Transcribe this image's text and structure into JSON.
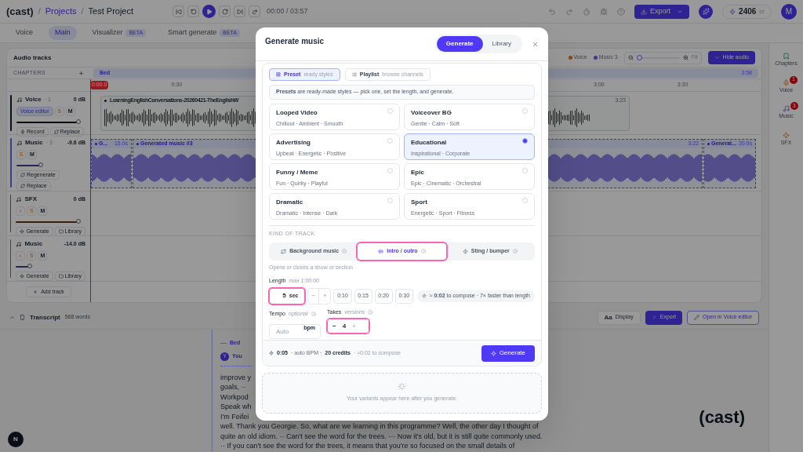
{
  "topbar": {
    "logo": "(cast)",
    "breadcrumbs": [
      {
        "separator": "/",
        "label": "Projects",
        "kind": "link"
      },
      {
        "separator": "/",
        "label": "Test Project",
        "kind": "current"
      }
    ],
    "time": "00:00 / 03:57",
    "export_label": "Export",
    "credits": "2406",
    "credits_unit": "cr",
    "avatar": "M"
  },
  "tabs": [
    {
      "label": "Voice",
      "selected": false
    },
    {
      "label": "Main",
      "selected": true
    },
    {
      "label": "Visualizer",
      "badge": "BETA",
      "selected": false
    },
    {
      "label": "Smart generate",
      "badge": "BETA",
      "selected": false
    }
  ],
  "audio": {
    "title": "Audio tracks",
    "legend": [
      {
        "label": "Voice",
        "color": "#95450d"
      },
      {
        "label": "Music 3",
        "color": "#3b3d91"
      }
    ],
    "fit": "Fit",
    "hide_button": "Hide audio",
    "chapters_label": "CHAPTERS",
    "chapter": {
      "name": "Bed",
      "end": "3:58"
    },
    "playhead": "0:00.0",
    "ticks": [
      "0:30",
      "3:00",
      "3:30"
    ],
    "tracks": [
      {
        "name": "Voice",
        "count": "· 1",
        "gain": "0 dB",
        "color": "#0a0e17",
        "level": 0.9,
        "removable": false,
        "editor": "Voice editor",
        "solo": "S",
        "mute": "M",
        "actions": [
          "Record",
          "Replace"
        ],
        "clips": [
          {
            "title": "LearningEnglishConversations-20260421-TheEnglishW",
            "end": "3:23"
          }
        ]
      },
      {
        "name": "Music",
        "count": "· 3",
        "gain": "-9.6 dB",
        "color": "#3b3d91",
        "level": 0.35,
        "removable": false,
        "solo": "S",
        "mute": "M",
        "actions": [
          "Regenerate",
          "Replace"
        ],
        "clips": [
          {
            "title": "G...",
            "end": "15.0s"
          },
          {
            "title": "Generated music #3",
            "end": "3:22"
          },
          {
            "title": "General...",
            "end": "20.0s"
          }
        ]
      },
      {
        "name": "SFX",
        "gain": "0 dB",
        "color": "#6c3205",
        "level": 0.9,
        "removable": true,
        "solo": "S",
        "mute": "M",
        "actions": [
          "Generate",
          "Library"
        ]
      },
      {
        "name": "Music",
        "gain": "-14.0 dB",
        "color": "#3b3d91",
        "level": 0.2,
        "removable": true,
        "solo": "S",
        "mute": "M",
        "actions": [
          "Generate",
          "Library"
        ]
      }
    ],
    "add_track": "Add track"
  },
  "sidebar": [
    {
      "label": "Chapters",
      "kind": "chapters"
    },
    {
      "label": "Voice",
      "kind": "voice",
      "badge": "1"
    },
    {
      "label": "Music",
      "kind": "music",
      "badge": "3"
    },
    {
      "label": "SFX",
      "kind": "sfx"
    }
  ],
  "transcript": {
    "title": "Transcript",
    "count": "568 words",
    "buttons": [
      {
        "label": "Display",
        "kind": "display",
        "glyph": "Aa"
      },
      {
        "label": "Export",
        "kind": "export"
      },
      {
        "label": "Open in Voice editor",
        "kind": "editor"
      }
    ],
    "chapter": "Bed",
    "speaker_initial": "Y",
    "speaker": "You",
    "lines": [
      "improve y",
      "goals, ··",
      "Workpod",
      "Speak wh",
      "I'm Feifei",
      "well. Thank you Georgie. So, what are we learning in this programme? Well, the other day I thought of",
      "quite an old idiom. ··  Can't see the word for the trees. ···  Now it's old, but it is still quite commonly used.",
      "··  If you can't see the word for the trees, it means that you're so focused on the small details of"
    ]
  },
  "corner_badge": "N",
  "watermark_logo": "(cast)",
  "modal": {
    "title": "Generate music",
    "switch": [
      {
        "label": "Generate",
        "selected": true
      },
      {
        "label": "Library",
        "selected": false
      }
    ],
    "modes": [
      {
        "label": "Preset",
        "hint": "ready styles",
        "kind": "preset",
        "selected": true
      },
      {
        "label": "Playlist",
        "hint": "browse channels",
        "kind": "playlist",
        "selected": false
      }
    ],
    "info": "**Presets** are ready-made styles — pick one, set the length, and generate.",
    "presets": [
      {
        "name": "Looped Video",
        "tags": "Chillout · Ambient · Smooth",
        "selected": false
      },
      {
        "name": "Voiceover BG",
        "tags": "Gentle · Calm · Soft",
        "selected": false
      },
      {
        "name": "Advertising",
        "tags": "Upbeat · Energetic · Positive",
        "selected": false
      },
      {
        "name": "Educational",
        "tags": "Inspirational · Corporate",
        "selected": true
      },
      {
        "name": "Funny / Meme",
        "tags": "Fun · Quirky · Playful",
        "selected": false
      },
      {
        "name": "Epic",
        "tags": "Epic · Cinematic · Orchestral",
        "selected": false
      },
      {
        "name": "Dramatic",
        "tags": "Dramatic · Intense · Dark",
        "selected": false
      },
      {
        "name": "Sport",
        "tags": "Energetic · Sport · Fitness",
        "selected": false
      }
    ],
    "kind_label": "KIND OF TRACK",
    "kinds": [
      {
        "label": "Background music",
        "kind": "loop",
        "selected": false
      },
      {
        "label": "Intro / outro",
        "kind": "intro",
        "selected": true
      },
      {
        "label": "Sting / bumper",
        "kind": "sting",
        "selected": false
      }
    ],
    "kind_hint": "Opens or closes a show or section",
    "length": {
      "label": "Length",
      "hint": "max 1:00:00",
      "value": "5",
      "unit": "sec",
      "highlighted": true,
      "minus": "−",
      "plus": "+",
      "presets": [
        "0:10",
        "0:15",
        "0:20",
        "0:30"
      ],
      "estimate": "≈ **0:02** to compose · 7× faster than length"
    },
    "tempo": {
      "label": "Tempo",
      "hint": "optional",
      "placeholder": "Auto",
      "unit": "bpm"
    },
    "takes": {
      "label": "Takes",
      "hint": "versions",
      "value": "4",
      "minus": "−",
      "plus": "+",
      "highlighted": true
    },
    "summary": {
      "duration": "0:05",
      "bpm": "· auto BPM ·",
      "credits": "20 credits",
      "compose": "· ≈0:02 to compose"
    },
    "generate": "Generate",
    "empty": "Your variants appear here after you generate."
  }
}
